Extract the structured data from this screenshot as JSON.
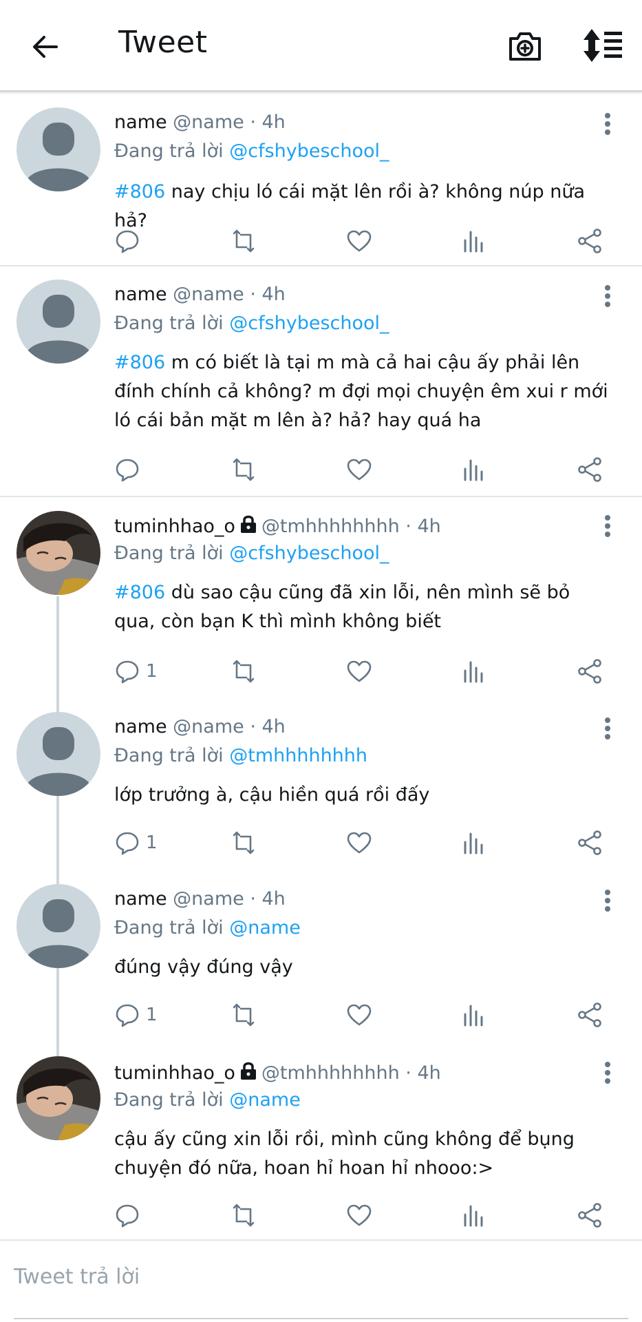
{
  "header": {
    "title": "Tweet",
    "back_icon": "arrow-left-icon",
    "camera_icon": "camera-plus-icon",
    "sort_icon": "sort-icon"
  },
  "colors": {
    "link": "#1da1f2",
    "secondary": "#657786",
    "divider": "#e1e5e8"
  },
  "tweets": [
    {
      "name": "name",
      "handle": "@name · 4h",
      "locked": false,
      "replying_prefix": "Đang trả lời ",
      "replying_to": "@cfshybeschool_",
      "hashtag": "#806",
      "text": " nay chịu ló cái mặt lên rồi à? không núp nữa hả?",
      "reply_count": "",
      "avatar": "default"
    },
    {
      "name": "name",
      "handle": "@name · 4h",
      "locked": false,
      "replying_prefix": "Đang trả lời ",
      "replying_to": "@cfshybeschool_",
      "hashtag": "#806",
      "text": " m có biết là tại m mà cả hai cậu ấy phải lên đính chính cả không? m đợi mọi chuyện êm xui r mới ló cái bản mặt m lên à? hả? hay quá ha",
      "reply_count": "",
      "avatar": "default"
    },
    {
      "name": "tuminhhao_o",
      "handle": "@tmhhhhhhhh · 4h",
      "locked": true,
      "replying_prefix": "Đang trả lời ",
      "replying_to": "@cfshybeschool_",
      "hashtag": "#806",
      "text": " dù sao cậu cũng đã xin lỗi, nên mình sẽ bỏ qua, còn bạn K thì mình không biết",
      "reply_count": "1",
      "avatar": "photo"
    },
    {
      "name": "name",
      "handle": "@name · 4h",
      "locked": false,
      "replying_prefix": "Đang trả lời ",
      "replying_to": "@tmhhhhhhhh",
      "hashtag": "",
      "text": "lớp trưởng à, cậu hiền quá rồi đấy",
      "reply_count": "1",
      "avatar": "default"
    },
    {
      "name": "name",
      "handle": "@name · 4h",
      "locked": false,
      "replying_prefix": "Đang trả lời ",
      "replying_to": "@name",
      "hashtag": "",
      "text": "đúng vậy đúng vậy",
      "reply_count": "1",
      "avatar": "default"
    },
    {
      "name": "tuminhhao_o",
      "handle": "@tmhhhhhhhh · 4h",
      "locked": true,
      "replying_prefix": "Đang trả lời ",
      "replying_to": "@name",
      "hashtag": "",
      "text": "cậu ấy cũng xin lỗi rồi, mình cũng không để bụng chuyện đó nữa, hoan hỉ hoan hỉ nhooo:>",
      "reply_count": "",
      "avatar": "photo"
    }
  ],
  "compose": {
    "placeholder": "Tweet trả lời"
  }
}
